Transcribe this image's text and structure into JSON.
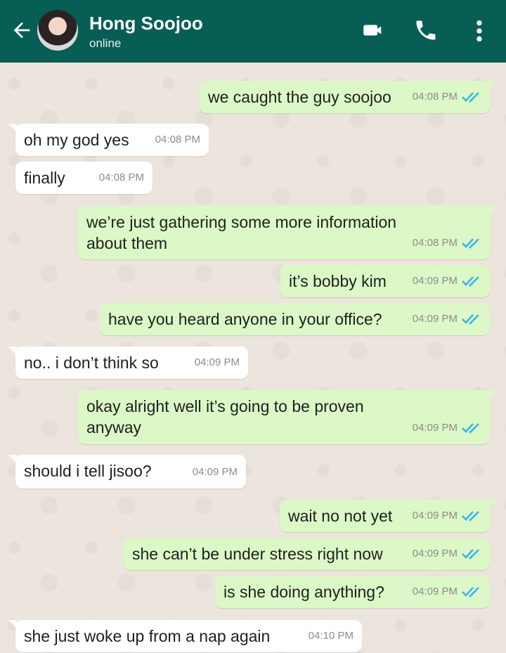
{
  "header": {
    "title": "Hong Soojoo",
    "status": "online",
    "icons": [
      "back-arrow-icon",
      "avatar",
      "video-camera-icon",
      "phone-icon",
      "more-vert-icon"
    ],
    "color": "#075e54"
  },
  "messages": [
    {
      "dir": "out",
      "text": "we caught the guy soojoo",
      "time": "04:08 PM"
    },
    {
      "dir": "in",
      "text": "oh my god yes",
      "time": "04:08 PM"
    },
    {
      "dir": "in",
      "text": "finally",
      "time": "04:08 PM"
    },
    {
      "dir": "out",
      "text": "we’re just gathering some more information\nabout them",
      "time": "04:08 PM"
    },
    {
      "dir": "out",
      "text": "it’s bobby kim",
      "time": "04:09 PM"
    },
    {
      "dir": "out",
      "text": "have you heard anyone in your office?",
      "time": "04:09 PM"
    },
    {
      "dir": "in",
      "text": "no.. i don’t think so",
      "time": "04:09 PM"
    },
    {
      "dir": "out",
      "text": "okay alright well it’s going to be proven\nanyway",
      "time": "04:09 PM"
    },
    {
      "dir": "in",
      "text": "should i tell jisoo?",
      "time": "04:09 PM"
    },
    {
      "dir": "out",
      "text": "wait no not yet",
      "time": "04:09 PM"
    },
    {
      "dir": "out",
      "text": "she can’t be under stress right now",
      "time": "04:09 PM"
    },
    {
      "dir": "out",
      "text": "is she doing anything?",
      "time": "04:09 PM"
    },
    {
      "dir": "in",
      "text": "she just woke up from a nap again",
      "time": "04:10 PM"
    }
  ],
  "colors": {
    "outgoing": "#dcf8c6",
    "incoming": "#ffffff",
    "read_tick": "#34b7f1"
  }
}
